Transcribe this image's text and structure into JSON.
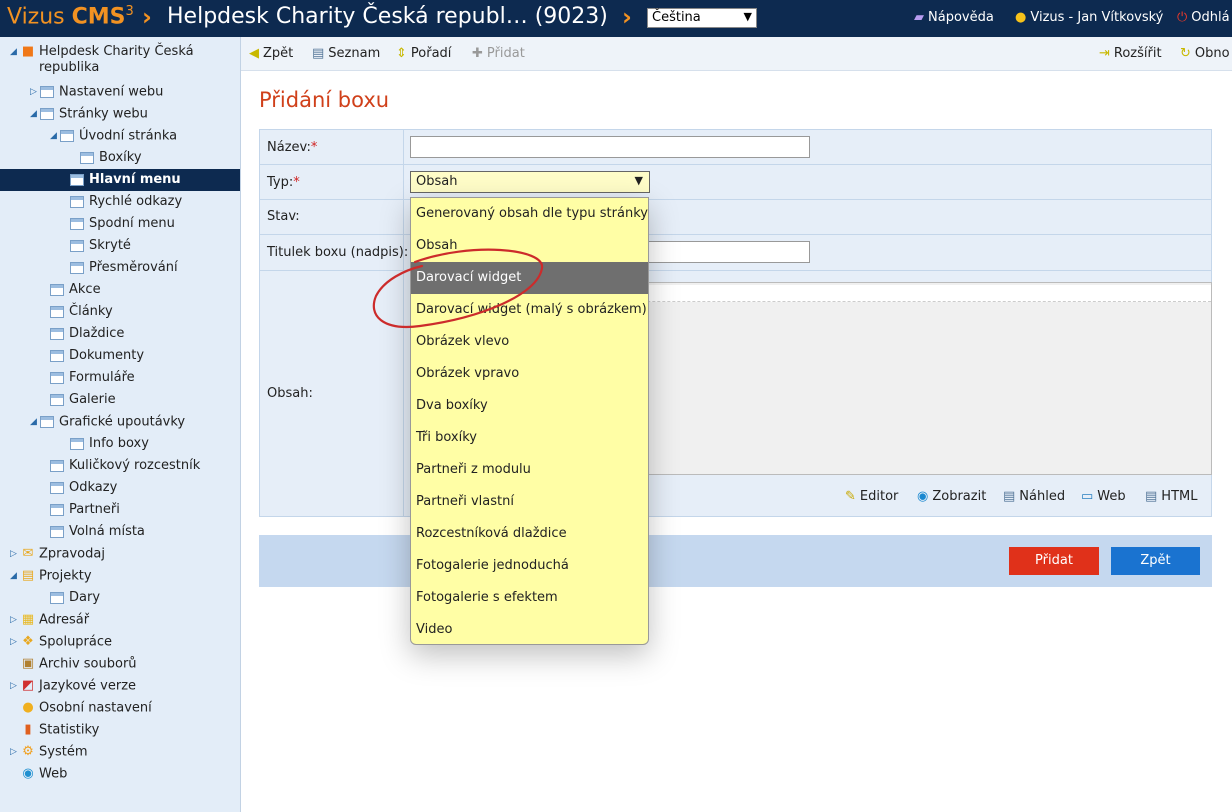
{
  "header": {
    "brand_prefix": "Vizus",
    "brand_main": "CMS",
    "brand_sup": "3",
    "site_title": "Helpdesk Charity Česká republ… (9023)",
    "language": "Čeština",
    "help": "Nápověda",
    "user": "Vizus - Jan Vítkovský",
    "logout": "Odhlá"
  },
  "sidebar": {
    "root_line1": "Helpdesk Charity Česká",
    "root_line2": "republika",
    "items": [
      "Nastavení webu",
      "Stránky webu",
      "Úvodní stránka",
      "Boxíky",
      "Hlavní menu",
      "Rychlé odkazy",
      "Spodní menu",
      "Skryté",
      "Přesměrování",
      "Akce",
      "Články",
      "Dlaždice",
      "Dokumenty",
      "Formuláře",
      "Galerie",
      "Grafické upoutávky",
      "Info boxy",
      "Kuličkový rozcestník",
      "Odkazy",
      "Partneři",
      "Volná místa",
      "Zpravodaj",
      "Projekty",
      "Dary",
      "Adresář",
      "Spolupráce",
      "Archiv souborů",
      "Jazykové verze",
      "Osobní nastavení",
      "Statistiky",
      "Systém",
      "Web"
    ]
  },
  "toolbar": {
    "back": "Zpět",
    "list": "Seznam",
    "order": "Pořadí",
    "add": "Přidat",
    "expand": "Rozšířit",
    "refresh": "Obno"
  },
  "form": {
    "title": "Přidání boxu",
    "name_label": "Název:",
    "type_label": "Typ:",
    "state_label": "Stav:",
    "box_title_label": "Titulek boxu (nadpis):",
    "content_label": "Obsah:",
    "type_value": "Obsah",
    "editor_tools": [
      "Editor",
      "Zobrazit",
      "Náhled",
      "Web",
      "HTML"
    ]
  },
  "actions": {
    "submit": "Přidat",
    "back": "Zpět"
  },
  "dropdown": {
    "highlighted": "Darovací widget",
    "options": [
      "Generovaný obsah dle typu stránky",
      "Obsah",
      "Darovací widget",
      "Darovací widget (malý s obrázkem)",
      "Obrázek vlevo",
      "Obrázek vpravo",
      "Dva boxíky",
      "Tři boxíky",
      "Partneři z modulu",
      "Partneři vlastní",
      "Rozcestníková dlaždice",
      "Fotogalerie jednoduchá",
      "Fotogalerie s efektem",
      "Video"
    ]
  },
  "colors": {
    "header_bg": "#0d2a50",
    "accent_orange": "#f29222",
    "title_red": "#d0401a",
    "sidebar_bg": "#e3edf8",
    "dropdown_bg": "#fffea5",
    "btn_red": "#e0311a",
    "btn_blue": "#1a73d0"
  }
}
